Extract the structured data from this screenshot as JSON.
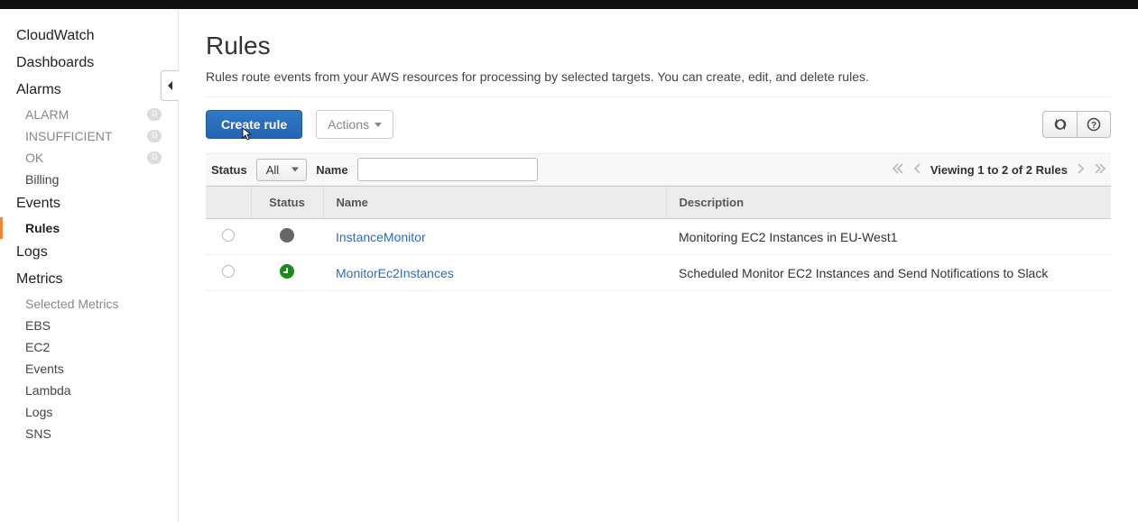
{
  "sidebar": {
    "top": "CloudWatch",
    "items": [
      {
        "label": "Dashboards"
      },
      {
        "label": "Alarms"
      }
    ],
    "alarm_subs": [
      {
        "label": "ALARM",
        "badge": "0"
      },
      {
        "label": "INSUFFICIENT",
        "badge": "0"
      },
      {
        "label": "OK",
        "badge": "0"
      },
      {
        "label": "Billing"
      }
    ],
    "events": "Events",
    "events_subs": [
      {
        "label": "Rules",
        "active": true
      }
    ],
    "logs": "Logs",
    "metrics": "Metrics",
    "metrics_subs": [
      {
        "label": "Selected Metrics",
        "muted": true
      },
      {
        "label": "EBS"
      },
      {
        "label": "EC2"
      },
      {
        "label": "Events"
      },
      {
        "label": "Lambda"
      },
      {
        "label": "Logs"
      },
      {
        "label": "SNS"
      }
    ]
  },
  "page": {
    "title": "Rules",
    "description": "Rules route events from your AWS resources for processing by selected targets. You can create, edit, and delete rules."
  },
  "toolbar": {
    "create_label": "Create rule",
    "actions_label": "Actions"
  },
  "filter": {
    "status_label": "Status",
    "status_value": "All",
    "name_label": "Name",
    "name_value": "",
    "pager_text": "Viewing 1 to 2 of 2 Rules"
  },
  "table": {
    "headers": {
      "status": "Status",
      "name": "Name",
      "description": "Description"
    },
    "rows": [
      {
        "status": "grey",
        "name": "InstanceMonitor",
        "description": "Monitoring EC2 Instances in EU-West1"
      },
      {
        "status": "green",
        "name": "MonitorEc2Instances",
        "description": "Scheduled Monitor EC2 Instances and Send Notifications to Slack"
      }
    ]
  }
}
